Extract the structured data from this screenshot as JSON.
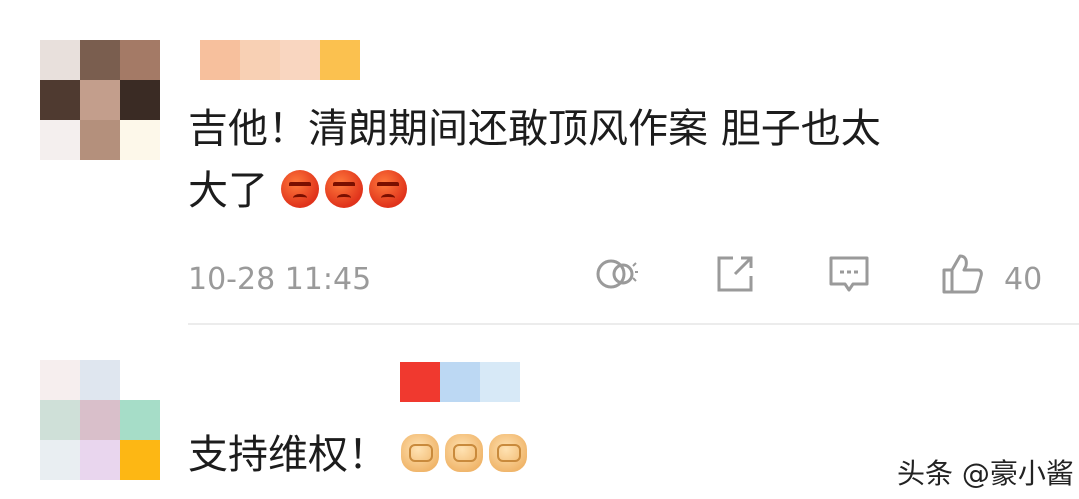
{
  "comments": [
    {
      "text_line1": "吉他！清朗期间还敢顶风作案 胆子也太",
      "text_line2": "大了",
      "emoji": [
        "angry-face",
        "angry-face",
        "angry-face"
      ],
      "timestamp": "10-28 11:45",
      "like_count": "40",
      "icons": [
        "repost-icon",
        "share-icon",
        "comment-icon",
        "like-icon"
      ]
    },
    {
      "text": "支持维权！",
      "emoji": [
        "fist-icon",
        "fist-icon",
        "fist-icon"
      ]
    }
  ],
  "watermark": "头条 @豪小酱",
  "colors": {
    "text": "#1c1c1c",
    "meta": "#9a9a9a",
    "divider": "#ececec"
  }
}
